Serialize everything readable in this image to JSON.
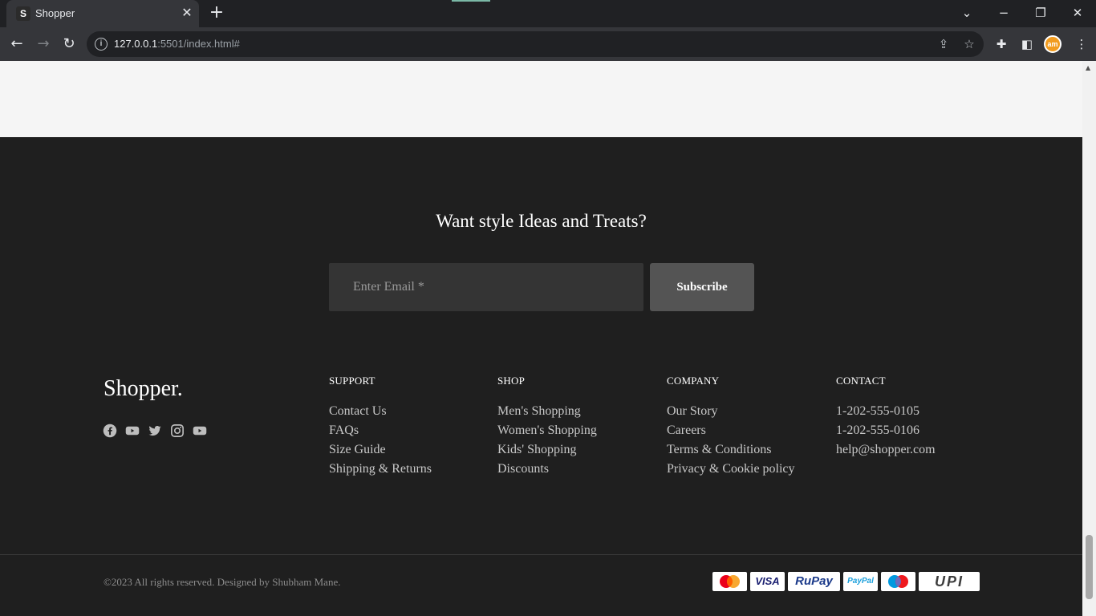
{
  "browser": {
    "tab_title": "Shopper",
    "favicon_letter": "S",
    "url_host": "127.0.0.1",
    "url_rest": ":5501/index.html#",
    "profile_initials": "am"
  },
  "newsletter": {
    "title": "Want style Ideas and Treats?",
    "email_placeholder": "Enter Email *",
    "subscribe_label": "Subscribe"
  },
  "brand": {
    "name": "Shopper.",
    "socials": [
      "facebook-icon",
      "youtube-icon",
      "twitter-icon",
      "instagram-icon",
      "youtube-icon"
    ]
  },
  "columns": {
    "support": {
      "title": "SUPPORT",
      "links": [
        "Contact Us",
        "FAQs",
        "Size Guide",
        "Shipping & Returns"
      ]
    },
    "shop": {
      "title": "SHOP",
      "links": [
        "Men's Shopping",
        "Women's Shopping",
        "Kids' Shopping",
        "Discounts"
      ]
    },
    "company": {
      "title": "COMPANY",
      "links": [
        "Our Story",
        "Careers",
        "Terms & Conditions",
        "Privacy & Cookie policy"
      ]
    },
    "contact": {
      "title": "CONTACT",
      "links": [
        "1-202-555-0105",
        "1-202-555-0106",
        "help@shopper.com"
      ]
    }
  },
  "bottom": {
    "copyright": "©2023 All rights reserved. Designed by Shubham Mane."
  },
  "payments": {
    "visa": "VISA",
    "rupay": "RuPay",
    "paypal": "PayPal",
    "upi": "UPI"
  },
  "colors": {
    "footer_bg": "#1f1f1f",
    "light_bg": "#f5f5f5",
    "input_bg": "#343434",
    "button_bg": "#545454"
  }
}
